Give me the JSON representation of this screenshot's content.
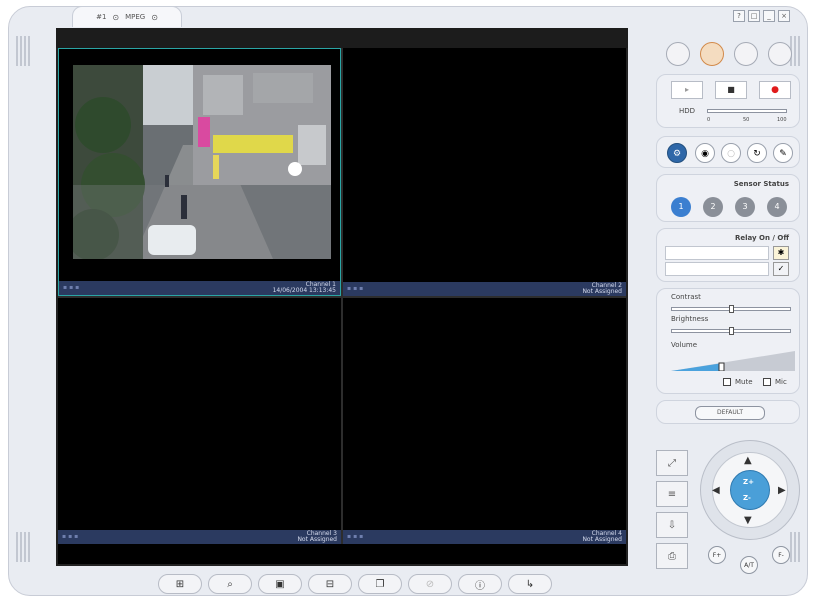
{
  "window": {
    "tab_label": "#1",
    "tab_sub": "MPEG",
    "system_buttons": [
      "?",
      "□",
      "_",
      "×"
    ]
  },
  "cameras": [
    {
      "line1": "Channel 1",
      "line2": "14/06/2004 13:13:45"
    },
    {
      "line1": "Channel 2",
      "line2": "Not Assigned"
    },
    {
      "line1": "Channel 3",
      "line2": "Not Assigned"
    },
    {
      "line1": "Channel 4",
      "line2": "Not Assigned"
    }
  ],
  "record": {
    "hdd_label": "HDD",
    "hdd_ticks": [
      "0",
      "50",
      "100"
    ]
  },
  "sensor_status": {
    "title": "Sensor Status",
    "items": [
      "1",
      "2",
      "3",
      "4"
    ]
  },
  "relay": {
    "title": "Relay On / Off"
  },
  "adjust": {
    "contrast_label": "Contrast",
    "brightness_label": "Brightness",
    "volume_label": "Volume",
    "mute_label": "Mute",
    "mic_label": "Mic",
    "contrast_value": 0.5,
    "brightness_value": 0.5,
    "volume_value": 0.4
  },
  "reset_button": {
    "label": "DEFAULT"
  },
  "ptz": {
    "zoom_in": "Z+",
    "zoom_out": "Z-",
    "focus_in": "F+",
    "focus_out": "F-",
    "auto": "A/T"
  },
  "colors": {
    "accent": "#4a9fd8",
    "video_bg": "#000000",
    "caption_bar": "#2b3a60",
    "active_border": "#2aa5a5"
  }
}
